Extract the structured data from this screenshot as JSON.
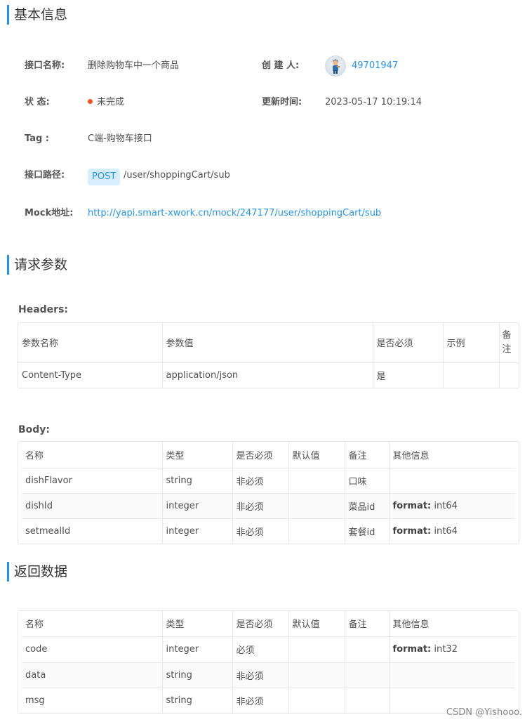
{
  "sections": {
    "basic_info": "基本信息",
    "request_params": "请求参数",
    "response_data": "返回数据"
  },
  "info": {
    "name_label": "接口名称:",
    "name_value": "删除购物车中一个商品",
    "creator_label": "创 建 人:",
    "creator_value": "49701947",
    "status_label": "状     态:",
    "status_value": "未完成",
    "updated_label": "更新时间:",
    "updated_value": "2023-05-17 10:19:14",
    "tag_label": "Tag :",
    "tag_value": "C端-购物车接口",
    "path_label": "接口路径:",
    "method": "POST",
    "path_value": "/user/shoppingCart/sub",
    "mock_label": "Mock地址:",
    "mock_value": "http://yapi.smart-xwork.cn/mock/247177/user/shoppingCart/sub"
  },
  "headers": {
    "title": "Headers:",
    "columns": [
      "参数名称",
      "参数值",
      "是否必须",
      "示例",
      "备注"
    ],
    "rows": [
      [
        "Content-Type",
        "application/json",
        "是",
        "",
        ""
      ]
    ]
  },
  "body": {
    "title": "Body:",
    "columns": [
      "名称",
      "类型",
      "是否必须",
      "默认值",
      "备注",
      "其他信息"
    ],
    "rows": [
      {
        "name": "dishFlavor",
        "type": "string",
        "required": "非必须",
        "default": "",
        "note": "口味",
        "extra_key": "",
        "extra_val": ""
      },
      {
        "name": "dishId",
        "type": "integer",
        "required": "非必须",
        "default": "",
        "note": "菜品id",
        "extra_key": "format:",
        "extra_val": "int64"
      },
      {
        "name": "setmealId",
        "type": "integer",
        "required": "非必须",
        "default": "",
        "note": "套餐id",
        "extra_key": "format:",
        "extra_val": "int64"
      }
    ]
  },
  "response": {
    "columns": [
      "名称",
      "类型",
      "是否必须",
      "默认值",
      "备注",
      "其他信息"
    ],
    "rows": [
      {
        "name": "code",
        "type": "integer",
        "required": "必须",
        "default": "",
        "note": "",
        "extra_key": "format:",
        "extra_val": "int32"
      },
      {
        "name": "data",
        "type": "string",
        "required": "非必须",
        "default": "",
        "note": "",
        "extra_key": "",
        "extra_val": ""
      },
      {
        "name": "msg",
        "type": "string",
        "required": "非必须",
        "default": "",
        "note": "",
        "extra_key": "",
        "extra_val": ""
      }
    ]
  },
  "watermark": "CSDN @Yishooo."
}
